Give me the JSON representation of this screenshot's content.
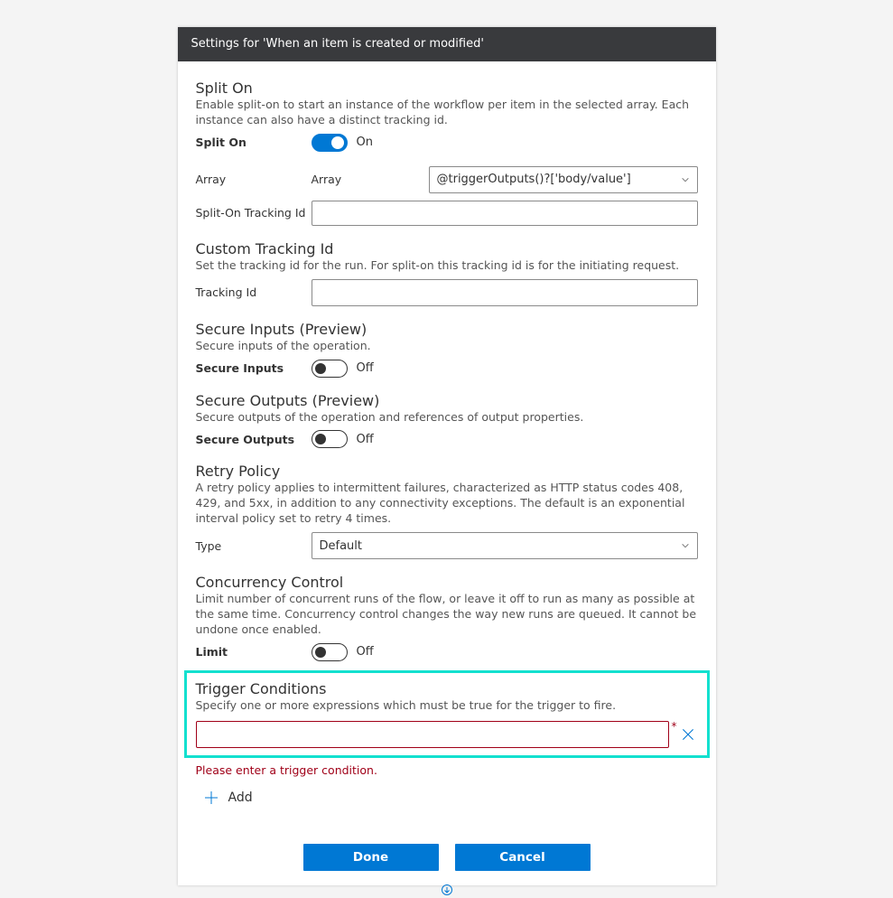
{
  "header": {
    "title": "Settings for 'When an item is created or modified'"
  },
  "split_on": {
    "title": "Split On",
    "desc": "Enable split-on to start an instance of the workflow per item in the selected array. Each instance can also have a distinct tracking id.",
    "toggle_label": "Split On",
    "toggle_state": "On",
    "array_label": "Array",
    "array_sublabel": "Array",
    "array_value": "@triggerOutputs()?['body/value']",
    "tracking_label": "Split-On Tracking Id",
    "tracking_value": ""
  },
  "custom_tracking": {
    "title": "Custom Tracking Id",
    "desc": "Set the tracking id for the run. For split-on this tracking id is for the initiating request.",
    "label": "Tracking Id",
    "value": ""
  },
  "secure_inputs": {
    "title": "Secure Inputs (Preview)",
    "desc": "Secure inputs of the operation.",
    "label": "Secure Inputs",
    "state": "Off"
  },
  "secure_outputs": {
    "title": "Secure Outputs (Preview)",
    "desc": "Secure outputs of the operation and references of output properties.",
    "label": "Secure Outputs",
    "state": "Off"
  },
  "retry": {
    "title": "Retry Policy",
    "desc": "A retry policy applies to intermittent failures, characterized as HTTP status codes 408, 429, and 5xx, in addition to any connectivity exceptions. The default is an exponential interval policy set to retry 4 times.",
    "label": "Type",
    "value": "Default"
  },
  "concurrency": {
    "title": "Concurrency Control",
    "desc": "Limit number of concurrent runs of the flow, or leave it off to run as many as possible at the same time. Concurrency control changes the way new runs are queued. It cannot be undone once enabled.",
    "label": "Limit",
    "state": "Off"
  },
  "trigger_conditions": {
    "title": "Trigger Conditions",
    "desc": "Specify one or more expressions which must be true for the trigger to fire.",
    "input_value": "",
    "error": "Please enter a trigger condition.",
    "add_label": "Add"
  },
  "footer": {
    "done": "Done",
    "cancel": "Cancel"
  }
}
